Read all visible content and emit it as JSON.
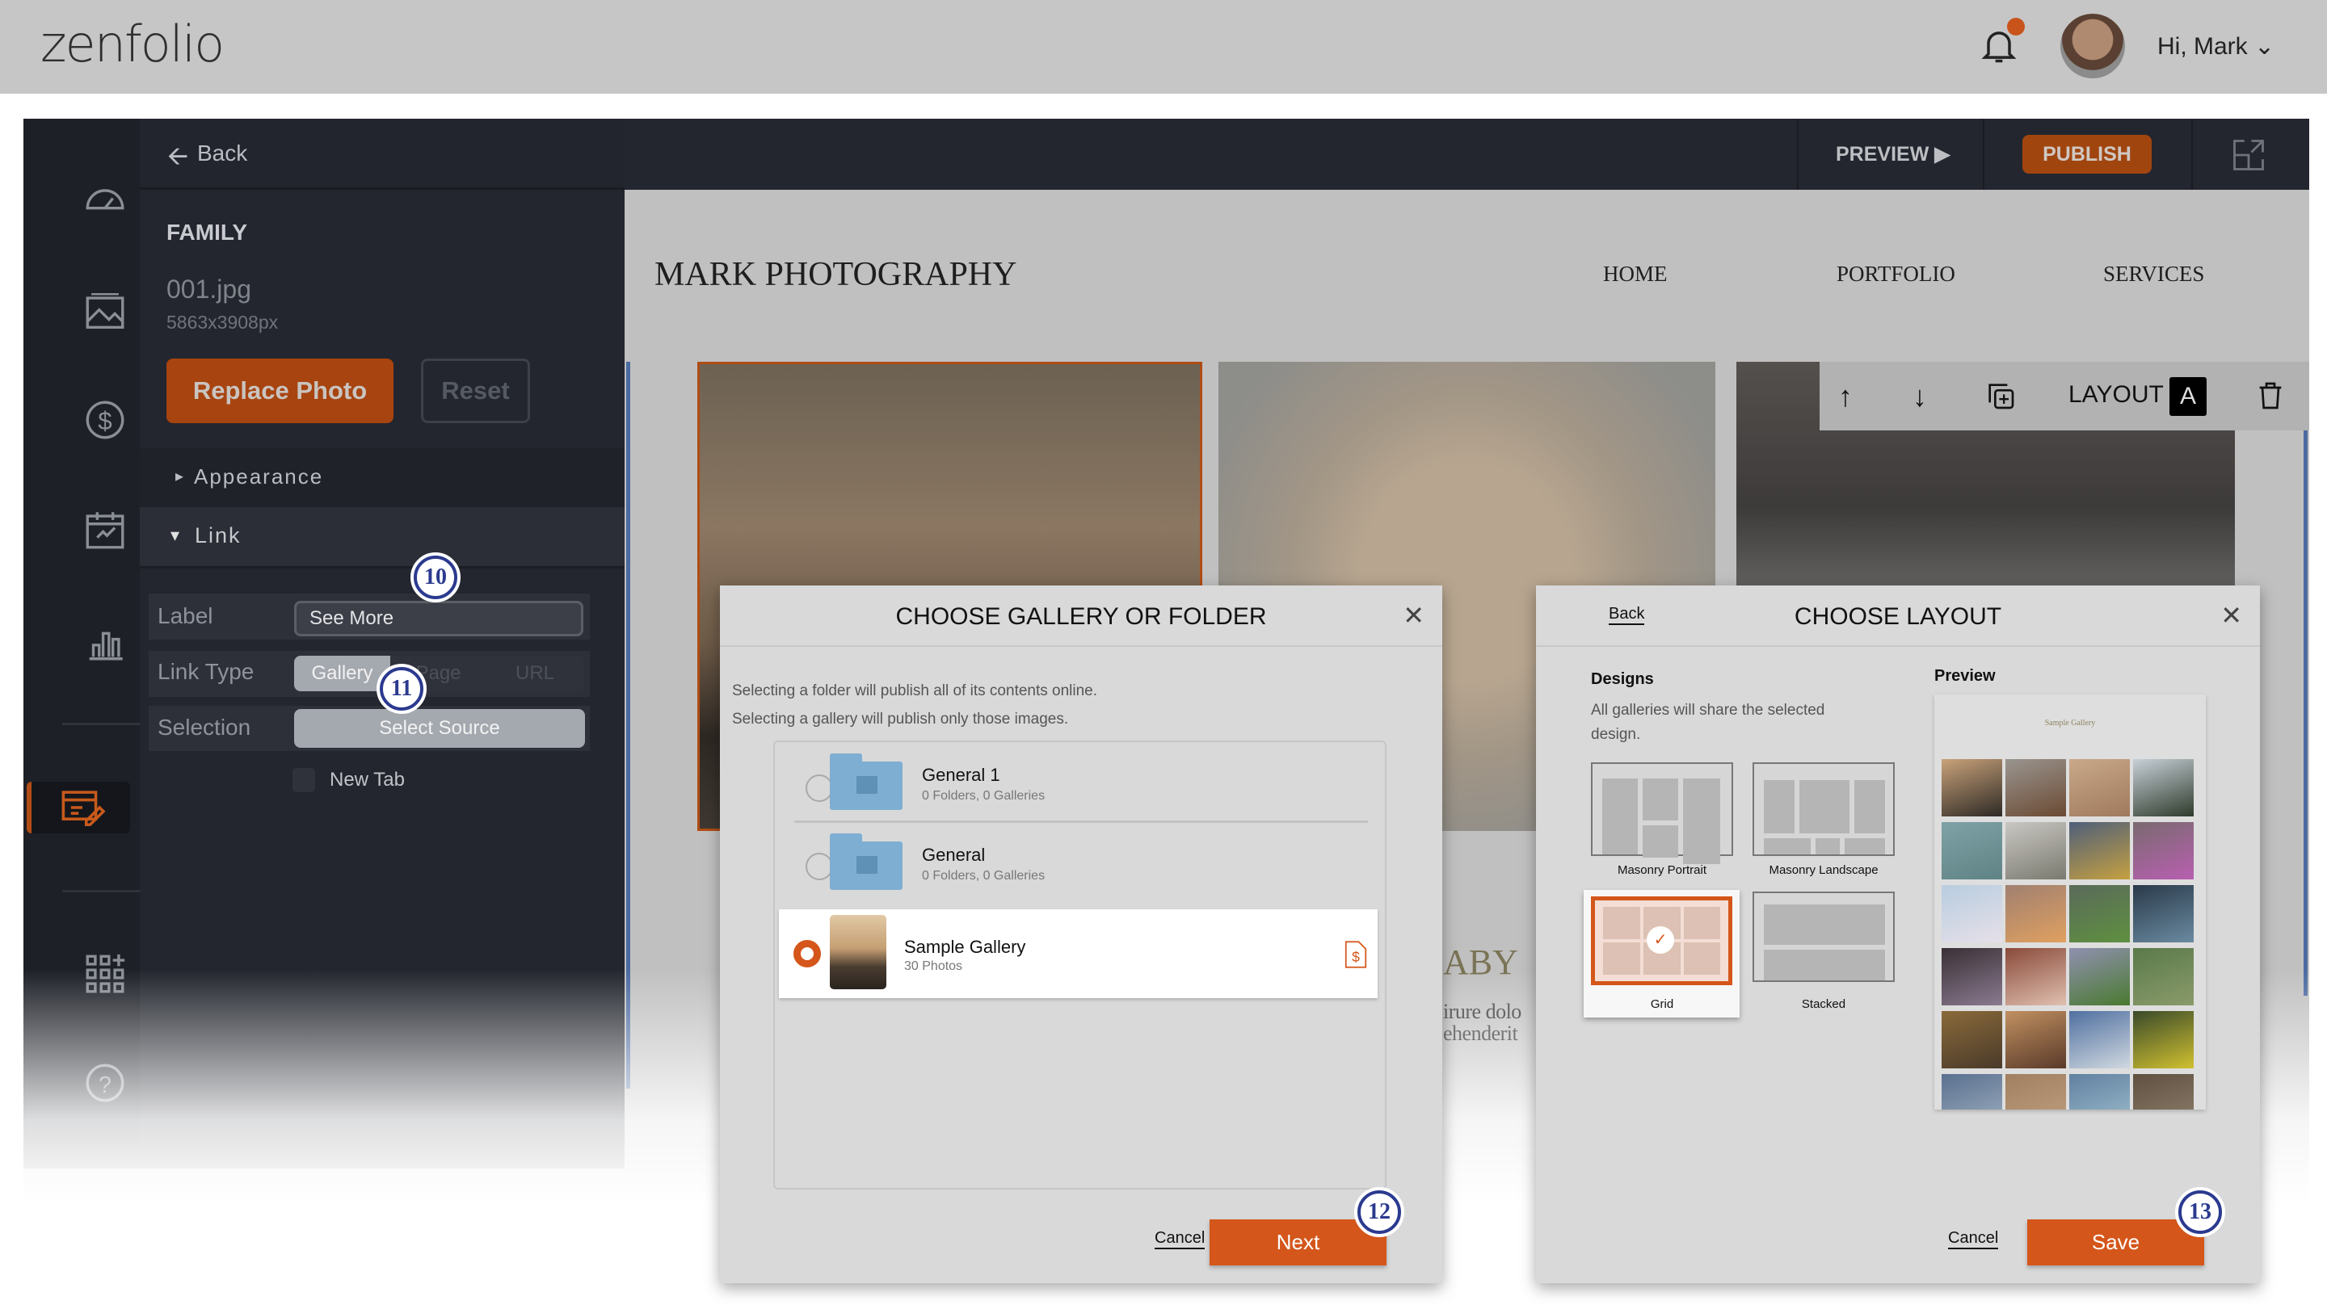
{
  "header": {
    "logo": "zenfolio",
    "greeting": "Hi, Mark"
  },
  "panel": {
    "back": "Back",
    "section": "FAMILY",
    "filename": "001.jpg",
    "dimensions": "5863x3908px",
    "replace_photo": "Replace Photo",
    "reset": "Reset",
    "appearance": "Appearance",
    "link": "Link",
    "label_field": {
      "label": "Label",
      "value": "See More"
    },
    "link_type": {
      "label": "Link Type",
      "options": [
        "Gallery",
        "Page",
        "URL"
      ],
      "selected": "Gallery"
    },
    "selection": {
      "label": "Selection",
      "button": "Select Source"
    },
    "new_tab": {
      "label": "New Tab",
      "checked": false
    }
  },
  "toolbar": {
    "preview": "PREVIEW",
    "publish": "PUBLISH"
  },
  "site": {
    "title": "MARK PHOTOGRAPHY",
    "nav": [
      "HOME",
      "PORTFOLIO",
      "SERVICES"
    ],
    "photo_toolbar": {
      "layout": "LAYOUT",
      "layout_value": "A"
    },
    "fragments": [
      "ABY",
      "irure dolo",
      "ehenderit"
    ]
  },
  "gallery_modal": {
    "title": "CHOOSE GALLERY OR FOLDER",
    "desc1": "Selecting a folder will publish all of its contents online.",
    "desc2": "Selecting a gallery will publish only those images.",
    "items": [
      {
        "name": "General 1",
        "sub": "0 Folders, 0 Galleries",
        "type": "folder",
        "selected": false
      },
      {
        "name": "General",
        "sub": "0 Folders, 0 Galleries",
        "type": "folder",
        "selected": false
      },
      {
        "name": "Sample Gallery",
        "sub": "30 Photos",
        "type": "gallery",
        "selected": true
      }
    ],
    "cancel": "Cancel",
    "next": "Next"
  },
  "layout_modal": {
    "back": "Back",
    "title": "CHOOSE LAYOUT",
    "designs": "Designs",
    "desc": "All galleries will share the selected design.",
    "preview": "Preview",
    "preview_title": "Sample Gallery",
    "options": [
      "Masonry Portrait",
      "Masonry Landscape",
      "Grid",
      "Stacked"
    ],
    "selected": "Grid",
    "cancel": "Cancel",
    "save": "Save"
  },
  "annotations": [
    "10",
    "11",
    "12",
    "13"
  ],
  "colors": {
    "accent": "#d4561a",
    "dark": "#23262e",
    "folder": "#7eaed2",
    "annotation": "#2b3a8f"
  }
}
